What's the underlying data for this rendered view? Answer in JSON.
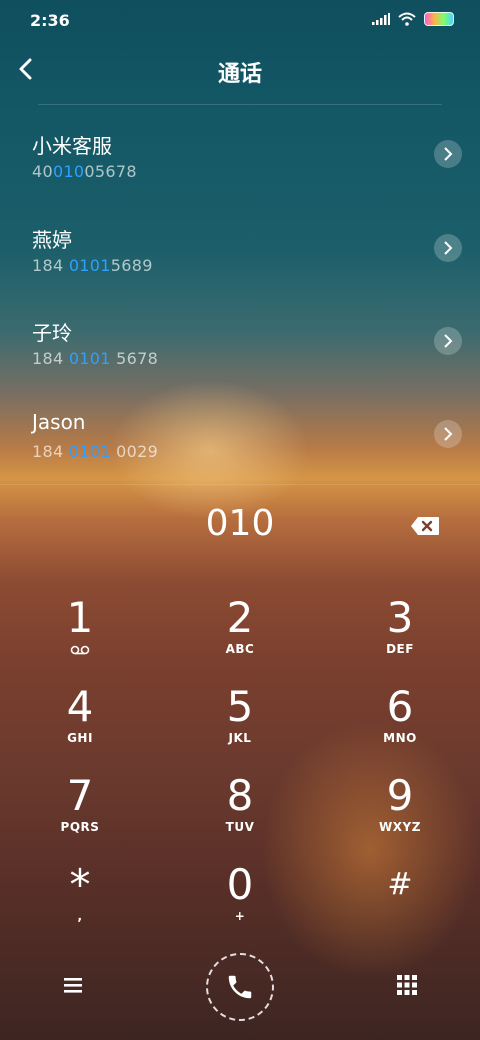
{
  "status": {
    "time": "2:36"
  },
  "header": {
    "title": "通话"
  },
  "contacts": [
    {
      "name": "小米客服",
      "num_pre": "40",
      "num_hl": "010",
      "num_post": "05678"
    },
    {
      "name": "燕婷",
      "num_pre": "184 ",
      "num_hl": "0101",
      "num_post": "5689"
    },
    {
      "name": "子玲",
      "num_pre": "184 ",
      "num_hl": "0101",
      "num_post": " 5678"
    },
    {
      "name": "Jason",
      "num_pre": "184 ",
      "num_hl": "0101",
      "num_post": " 0029"
    }
  ],
  "dialer": {
    "entry": "010",
    "keys": [
      {
        "digit": "1",
        "letters": ""
      },
      {
        "digit": "2",
        "letters": "ABC"
      },
      {
        "digit": "3",
        "letters": "DEF"
      },
      {
        "digit": "4",
        "letters": "GHI"
      },
      {
        "digit": "5",
        "letters": "JKL"
      },
      {
        "digit": "6",
        "letters": "MNO"
      },
      {
        "digit": "7",
        "letters": "PQRS"
      },
      {
        "digit": "8",
        "letters": "TUV"
      },
      {
        "digit": "9",
        "letters": "WXYZ"
      },
      {
        "digit": "*",
        "letters": ","
      },
      {
        "digit": "0",
        "letters": "+"
      },
      {
        "digit": "#",
        "letters": ""
      }
    ]
  },
  "icons": {
    "back": "back-arrow-icon",
    "chevron": "chevron-right-icon",
    "backspace": "backspace-icon",
    "voicemail": "voicemail-icon",
    "menu": "menu-icon",
    "call": "phone-icon",
    "keypad": "keypad-icon"
  }
}
